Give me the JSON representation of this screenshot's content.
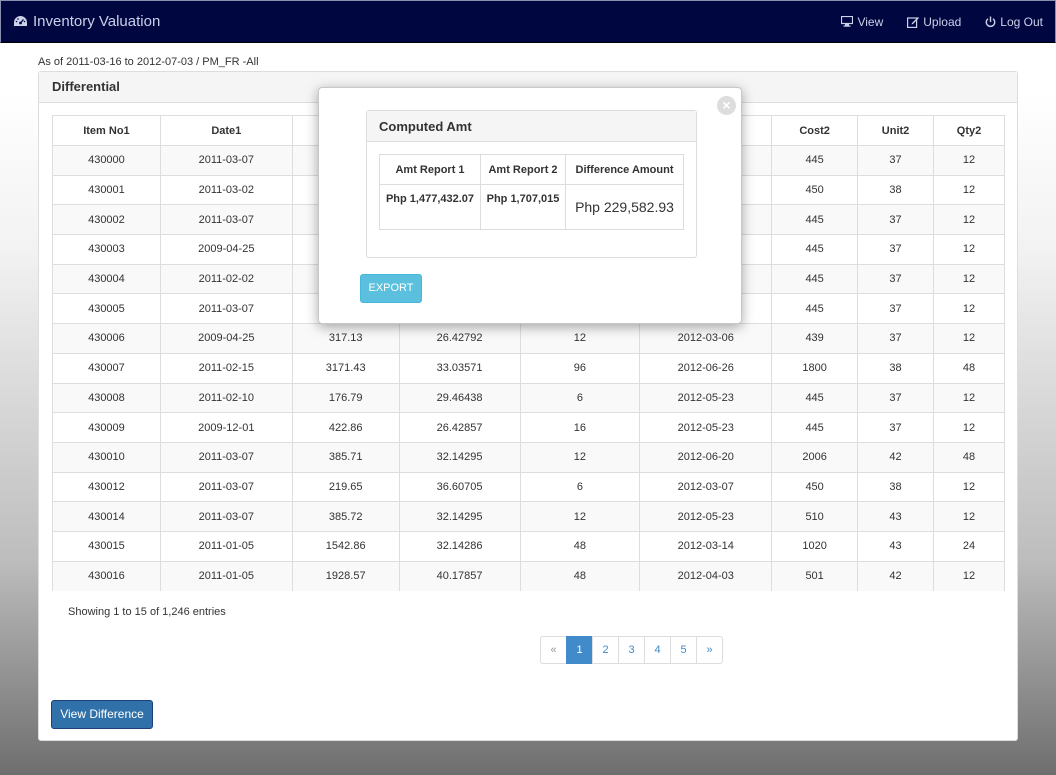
{
  "app": {
    "title": "Inventory Valuation",
    "nav": {
      "view": "View",
      "upload": "Upload",
      "logout": "Log Out"
    }
  },
  "range": "As of 2011-03-16 to 2012-07-03 / PM_FR -All",
  "panel": {
    "title": "Differential"
  },
  "table": {
    "headers": [
      "Item No1",
      "Date1",
      "",
      "",
      "",
      "",
      "Cost2",
      "Unit2",
      "Qty2"
    ],
    "rows": [
      [
        "430000",
        "2011-03-07",
        "",
        "",
        "",
        "",
        "445",
        "37",
        "12"
      ],
      [
        "430001",
        "2011-03-02",
        "",
        "",
        "",
        "",
        "450",
        "38",
        "12"
      ],
      [
        "430002",
        "2011-03-07",
        "",
        "",
        "",
        "",
        "445",
        "37",
        "12"
      ],
      [
        "430003",
        "2009-04-25",
        "",
        "",
        "",
        "",
        "445",
        "37",
        "12"
      ],
      [
        "430004",
        "2011-02-02",
        "",
        "",
        "",
        "",
        "445",
        "37",
        "12"
      ],
      [
        "430005",
        "2011-03-07",
        "",
        "",
        "",
        "",
        "445",
        "37",
        "12"
      ],
      [
        "430006",
        "2009-04-25",
        "317.13",
        "26.42792",
        "12",
        "2012-03-06",
        "439",
        "37",
        "12"
      ],
      [
        "430007",
        "2011-02-15",
        "3171.43",
        "33.03571",
        "96",
        "2012-06-26",
        "1800",
        "38",
        "48"
      ],
      [
        "430008",
        "2011-02-10",
        "176.79",
        "29.46438",
        "6",
        "2012-05-23",
        "445",
        "37",
        "12"
      ],
      [
        "430009",
        "2009-12-01",
        "422.86",
        "26.42857",
        "16",
        "2012-05-23",
        "445",
        "37",
        "12"
      ],
      [
        "430010",
        "2011-03-07",
        "385.71",
        "32.14295",
        "12",
        "2012-06-20",
        "2006",
        "42",
        "48"
      ],
      [
        "430012",
        "2011-03-07",
        "219.65",
        "36.60705",
        "6",
        "2012-03-07",
        "450",
        "38",
        "12"
      ],
      [
        "430014",
        "2011-03-07",
        "385.72",
        "32.14295",
        "12",
        "2012-05-23",
        "510",
        "43",
        "12"
      ],
      [
        "430015",
        "2011-01-05",
        "1542.86",
        "32.14286",
        "48",
        "2012-03-14",
        "1020",
        "43",
        "24"
      ],
      [
        "430016",
        "2011-01-05",
        "1928.57",
        "40.17857",
        "48",
        "2012-04-03",
        "501",
        "42",
        "12"
      ]
    ]
  },
  "footer": {
    "showing": "Showing 1 to 15 of 1,246 entries",
    "pagination": [
      "«",
      "1",
      "2",
      "3",
      "4",
      "5",
      "»"
    ],
    "active_page": "1",
    "view_difference": "View Difference"
  },
  "modal": {
    "title": "Computed Amt",
    "close_symbol": "×",
    "headers": [
      "Amt Report 1",
      "Amt Report 2",
      "Difference Amount"
    ],
    "values": [
      "Php 1,477,432.07",
      "Php 1,707,015",
      "Php 229,582.93"
    ],
    "export": "EXPORT"
  },
  "colors": {
    "navbar": "#000640",
    "primary": "#428bca",
    "info": "#5bc0de"
  }
}
